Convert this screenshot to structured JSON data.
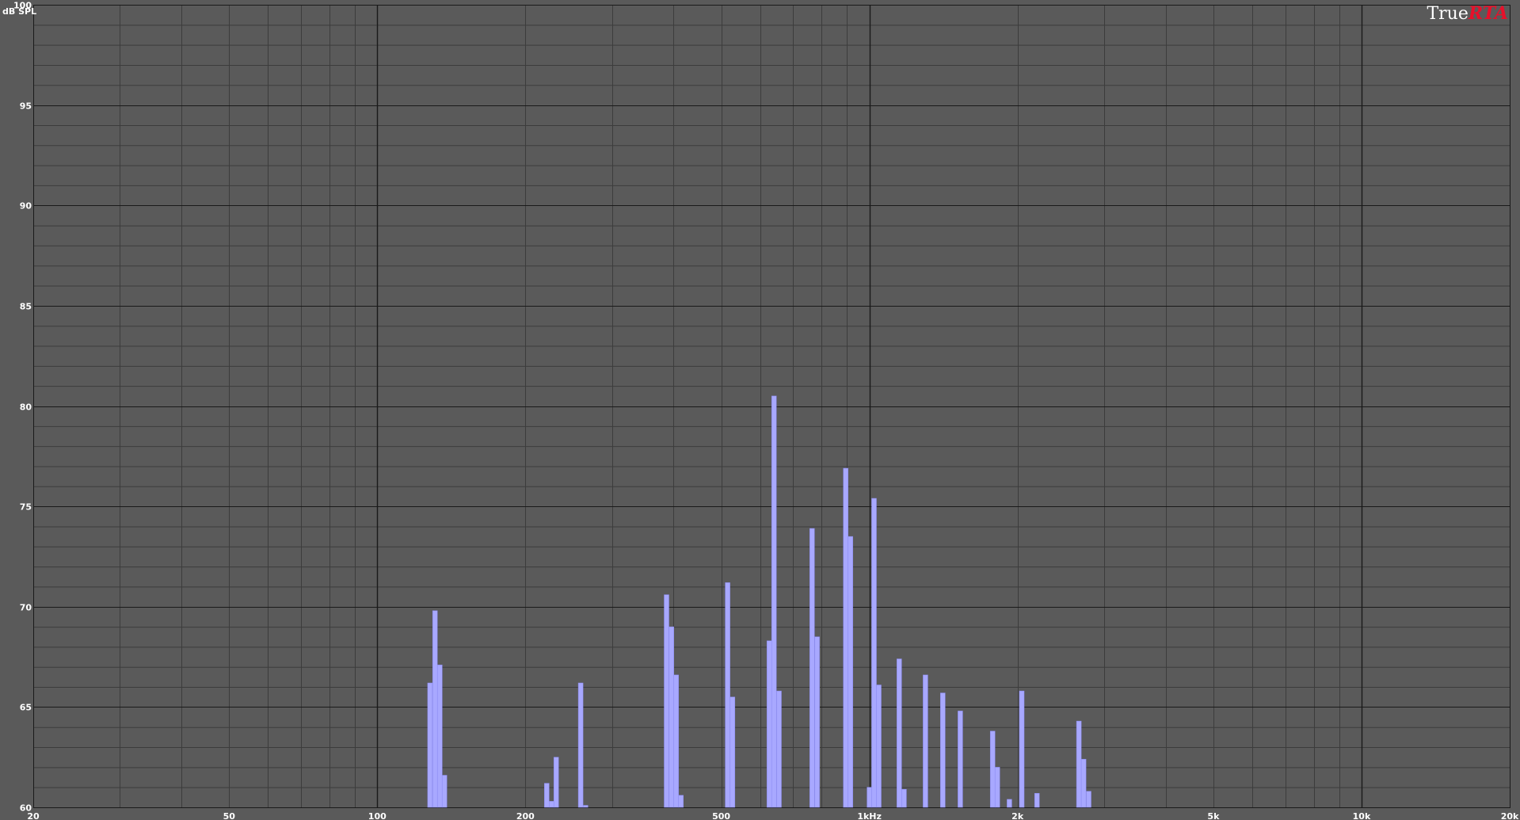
{
  "chart_data": {
    "type": "bar",
    "ylabel": "dB SPL",
    "ylim": [
      60,
      100
    ],
    "x_scale": "log",
    "xlim": [
      20,
      20000
    ],
    "grid": true,
    "y_ticks": [
      {
        "value": 60,
        "label": "60"
      },
      {
        "value": 65,
        "label": "65"
      },
      {
        "value": 70,
        "label": "70"
      },
      {
        "value": 75,
        "label": "75"
      },
      {
        "value": 80,
        "label": "80"
      },
      {
        "value": 85,
        "label": "85"
      },
      {
        "value": 90,
        "label": "90"
      },
      {
        "value": 95,
        "label": "95"
      },
      {
        "value": 100,
        "label": "100"
      }
    ],
    "x_ticks": [
      {
        "value": 20,
        "label": "20"
      },
      {
        "value": 50,
        "label": "50"
      },
      {
        "value": 100,
        "label": "100"
      },
      {
        "value": 200,
        "label": "200"
      },
      {
        "value": 500,
        "label": "500"
      },
      {
        "value": 1000,
        "label": "1kHz"
      },
      {
        "value": 2000,
        "label": "2k"
      },
      {
        "value": 5000,
        "label": "5k"
      },
      {
        "value": 10000,
        "label": "10k"
      },
      {
        "value": 20000,
        "label": "20k"
      }
    ],
    "bars": [
      {
        "freq": 128,
        "db": 66.2
      },
      {
        "freq": 131,
        "db": 69.8
      },
      {
        "freq": 134,
        "db": 67.1
      },
      {
        "freq": 137,
        "db": 61.6
      },
      {
        "freq": 221,
        "db": 61.2
      },
      {
        "freq": 226,
        "db": 60.3
      },
      {
        "freq": 231,
        "db": 62.5
      },
      {
        "freq": 259,
        "db": 66.2
      },
      {
        "freq": 265,
        "db": 60.1
      },
      {
        "freq": 387,
        "db": 70.6
      },
      {
        "freq": 396,
        "db": 69.0
      },
      {
        "freq": 405,
        "db": 66.6
      },
      {
        "freq": 414,
        "db": 60.6
      },
      {
        "freq": 515,
        "db": 71.2
      },
      {
        "freq": 527,
        "db": 65.5
      },
      {
        "freq": 626,
        "db": 68.3
      },
      {
        "freq": 640,
        "db": 80.5
      },
      {
        "freq": 655,
        "db": 65.8
      },
      {
        "freq": 765,
        "db": 73.9
      },
      {
        "freq": 783,
        "db": 68.5
      },
      {
        "freq": 895,
        "db": 76.9
      },
      {
        "freq": 915,
        "db": 73.5
      },
      {
        "freq": 1000,
        "db": 61.0
      },
      {
        "freq": 1022,
        "db": 75.4
      },
      {
        "freq": 1045,
        "db": 66.1
      },
      {
        "freq": 1150,
        "db": 67.4
      },
      {
        "freq": 1176,
        "db": 60.9
      },
      {
        "freq": 1300,
        "db": 66.6
      },
      {
        "freq": 1410,
        "db": 65.7
      },
      {
        "freq": 1530,
        "db": 64.8
      },
      {
        "freq": 1780,
        "db": 63.8
      },
      {
        "freq": 1820,
        "db": 62.0
      },
      {
        "freq": 1925,
        "db": 60.4
      },
      {
        "freq": 2040,
        "db": 65.8
      },
      {
        "freq": 2140,
        "db": 60.0
      },
      {
        "freq": 2190,
        "db": 60.7
      },
      {
        "freq": 2665,
        "db": 64.3
      },
      {
        "freq": 2725,
        "db": 62.4
      },
      {
        "freq": 2790,
        "db": 60.8
      }
    ]
  },
  "logo": {
    "part1": "True",
    "part2": "RTA"
  },
  "colors": {
    "plot_background": "#5a5a5a",
    "grid_major": "#1a1a1a",
    "grid_minor": "#3c3c3c",
    "bar_fill": "#a8a8ff",
    "bar_edge": "#8a8af0",
    "logo_accent": "#e8102a"
  }
}
